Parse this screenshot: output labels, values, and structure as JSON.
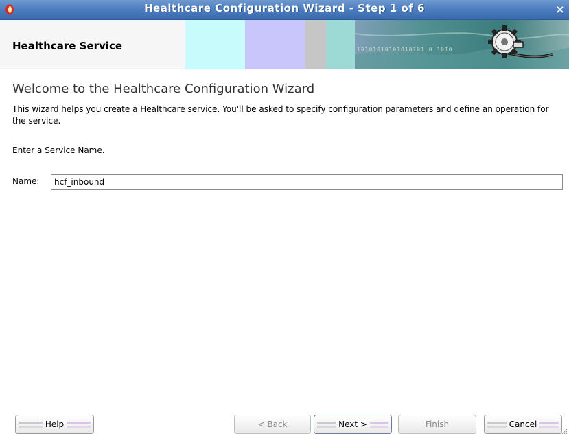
{
  "window": {
    "title": "Healthcare Configuration Wizard - Step 1 of 6",
    "close_glyph": "×"
  },
  "header": {
    "title": "Healthcare Service",
    "bits_text": "10101010101010101 0 1010"
  },
  "content": {
    "heading": "Welcome to the Healthcare Configuration Wizard",
    "description": "This wizard helps you create a Healthcare service. You'll be asked to specify configuration parameters and define an operation for the service.",
    "prompt": "Enter a Service Name.",
    "name_label_mnemonic": "N",
    "name_label_rest": "ame:",
    "name_value": "hcf_inbound"
  },
  "buttons": {
    "help": {
      "mnemonic": "H",
      "rest": "elp"
    },
    "back": {
      "prefix": "< ",
      "mnemonic": "B",
      "rest": "ack"
    },
    "next": {
      "mnemonic": "N",
      "rest": "ext >"
    },
    "finish": {
      "mnemonic": "F",
      "rest": "inish"
    },
    "cancel": {
      "label": "Cancel"
    }
  },
  "colors": {
    "titlebar": "#4c7dbf",
    "banner_cyan": "#c8fbfb",
    "banner_lavender": "#c9c6fb",
    "banner_gray": "#c6c6c6",
    "banner_teal": "#9ddad5",
    "banner_dark_teal": "#4f8f8f"
  }
}
